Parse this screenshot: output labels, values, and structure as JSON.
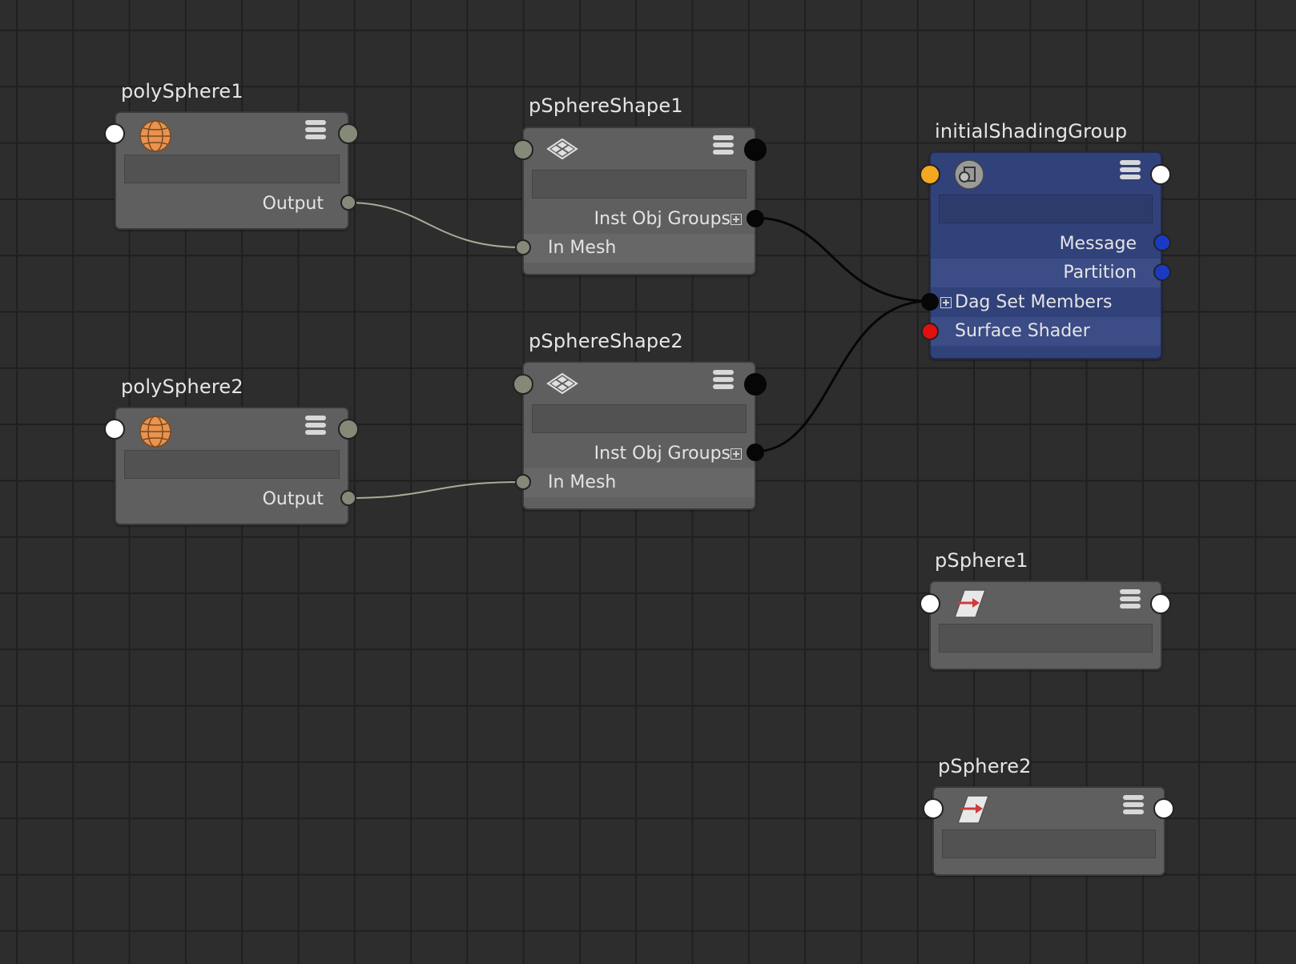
{
  "app": {
    "view": "Node Editor"
  },
  "colors": {
    "canvas": "#2d2d2d",
    "node_body": "#5f5f5f",
    "shading_group_body": "#31417a",
    "wire_gray": "#a9aa97",
    "wire_black": "#060606",
    "port_white": "#ffffff",
    "port_gray": "#858a78",
    "port_orange": "#f3a81f",
    "port_blue": "#1a3ac4",
    "port_red": "#e20f0f"
  },
  "nodes": {
    "polySphere1": {
      "title": "polySphere1",
      "icon": "poly-sphere-icon",
      "attrs": {
        "output": "Output"
      }
    },
    "polySphere2": {
      "title": "polySphere2",
      "icon": "poly-sphere-icon",
      "attrs": {
        "output": "Output"
      }
    },
    "pSphereShape1": {
      "title": "pSphereShape1",
      "icon": "mesh-shape-icon",
      "attrs": {
        "inst_obj_groups": "Inst Obj Groups",
        "in_mesh": "In Mesh"
      }
    },
    "pSphereShape2": {
      "title": "pSphereShape2",
      "icon": "mesh-shape-icon",
      "attrs": {
        "inst_obj_groups": "Inst Obj Groups",
        "in_mesh": "In Mesh"
      }
    },
    "initialShadingGroup": {
      "title": "initialShadingGroup",
      "icon": "shading-group-icon",
      "attrs": {
        "message": "Message",
        "partition": "Partition",
        "dag_set_members": "Dag Set Members",
        "surface_shader": "Surface Shader"
      }
    },
    "pSphere1": {
      "title": "pSphere1",
      "icon": "transform-icon"
    },
    "pSphere2": {
      "title": "pSphere2",
      "icon": "transform-icon"
    }
  },
  "connections": [
    {
      "from": "polySphere1.Output",
      "to": "pSphereShape1.In Mesh"
    },
    {
      "from": "polySphere2.Output",
      "to": "pSphereShape2.In Mesh"
    },
    {
      "from": "pSphereShape1.Inst Obj Groups",
      "to": "initialShadingGroup.Dag Set Members"
    },
    {
      "from": "pSphereShape2.Inst Obj Groups",
      "to": "initialShadingGroup.Dag Set Members"
    }
  ]
}
